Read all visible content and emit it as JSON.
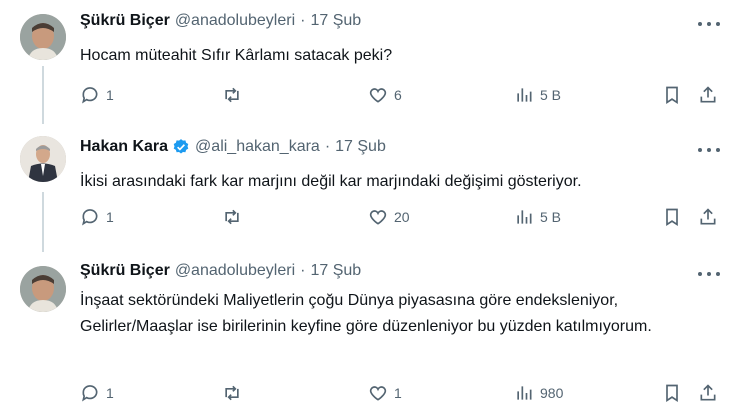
{
  "tweets": [
    {
      "name": "Şükrü Biçer",
      "handle": "@anadolubeyleri",
      "dot": "·",
      "date": "17 Şub",
      "verified": false,
      "text": "Hocam müteahit Sıfır Kârlamı satacak peki?",
      "replies": "1",
      "reposts": "",
      "likes": "6",
      "views": "5 B"
    },
    {
      "name": "Hakan Kara",
      "handle": "@ali_hakan_kara",
      "dot": "·",
      "date": "17 Şub",
      "verified": true,
      "text": "İkisi arasındaki fark kar marjını değil kar marjındaki değişimi gösteriyor.",
      "replies": "1",
      "reposts": "",
      "likes": "20",
      "views": "5 B"
    },
    {
      "name": "Şükrü Biçer",
      "handle": "@anadolubeyleri",
      "dot": "·",
      "date": "17 Şub",
      "verified": false,
      "text": "İnşaat sektöründeki Maliyetlerin çoğu Dünya piyasasına göre endeksleniyor, Gelirler/Maaşlar ise birilerinin keyfine göre düzenleniyor bu yüzden katılmıyorum.",
      "replies": "1",
      "reposts": "",
      "likes": "1",
      "views": "980"
    }
  ],
  "colors": {
    "text": "#0f1419",
    "muted": "#536471",
    "verified": "#1d9bf0",
    "line": "#cfd9de"
  },
  "icons": [
    "reply-icon",
    "repost-icon",
    "like-icon",
    "views-icon",
    "bookmark-icon",
    "share-icon",
    "more-icon",
    "verified-badge-icon"
  ]
}
